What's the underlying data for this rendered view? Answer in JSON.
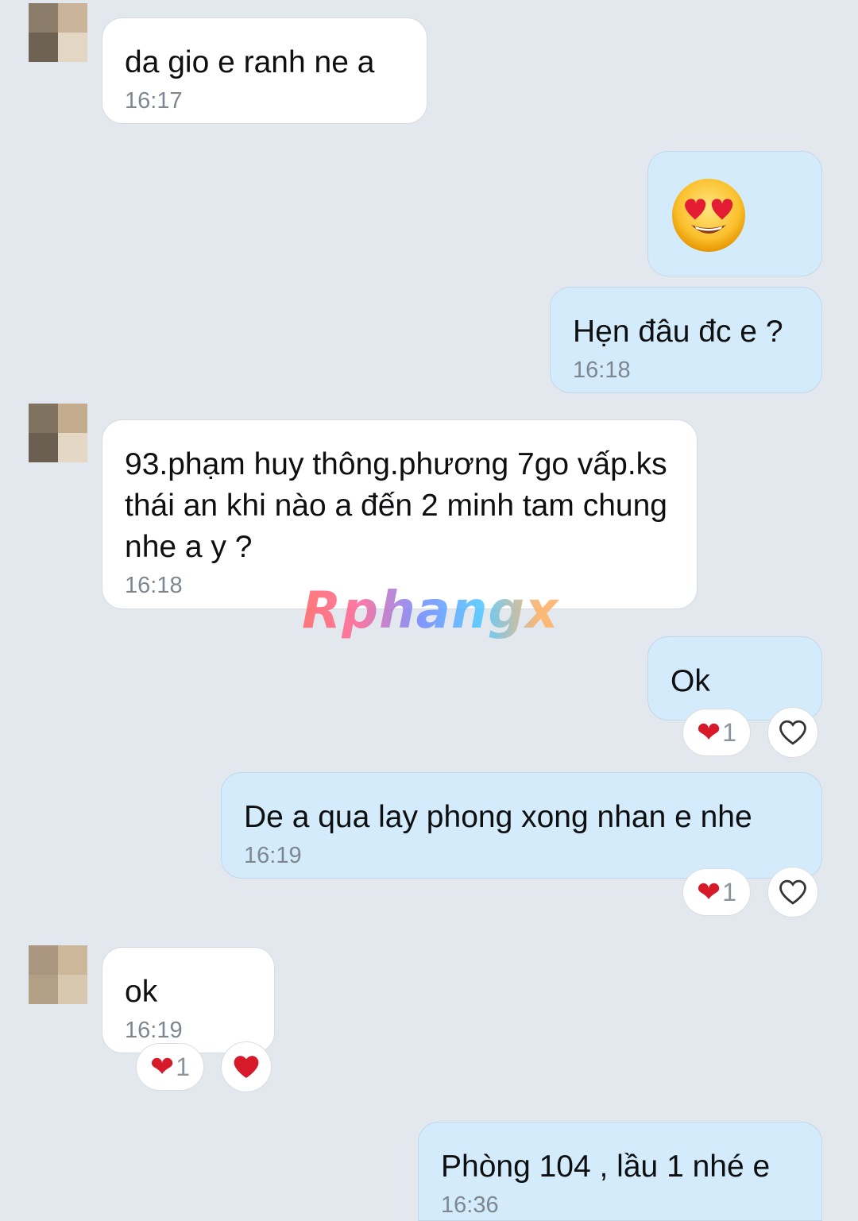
{
  "colors": {
    "background": "#e3e8ef",
    "incoming_bubble": "#ffffff",
    "outgoing_bubble": "#d3ebfa",
    "timestamp": "#7e8790",
    "heart": "#d71a2a"
  },
  "watermark": "Rphangx",
  "messages": [
    {
      "side": "incoming",
      "text": "da gio e ranh ne a",
      "time": "16:17"
    },
    {
      "side": "outgoing",
      "emoji": "heart-eyes-emoji"
    },
    {
      "side": "outgoing",
      "text": "Hẹn đâu đc e ?",
      "time": "16:18"
    },
    {
      "side": "incoming",
      "text": "93.phạm huy thông.phương 7go vấp.ks thái an khi nào a đến 2 minh tam chung nhe a y ?",
      "time": "16:18"
    },
    {
      "side": "outgoing",
      "text": "Ok",
      "reaction_count": "1"
    },
    {
      "side": "outgoing",
      "text": "De a qua lay phong xong nhan e nhe",
      "time": "16:19",
      "reaction_count": "1"
    },
    {
      "side": "incoming",
      "text": "ok",
      "time": "16:19",
      "reaction_count": "1"
    },
    {
      "side": "outgoing",
      "text": "Phòng 104 , lầu 1 nhé e",
      "time": "16:36"
    }
  ]
}
